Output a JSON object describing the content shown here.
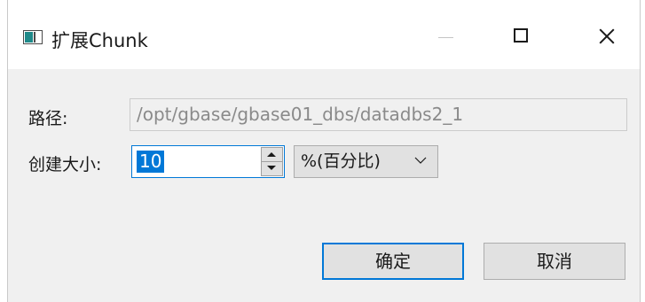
{
  "window": {
    "title": "扩展Chunk"
  },
  "titlebar_icons": {
    "app": "window-app-icon",
    "minimize": "minimize-icon",
    "maximize": "maximize-icon",
    "close": "close-icon"
  },
  "form": {
    "path_label": "路径:",
    "path_value": "/opt/gbase/gbase01_dbs/datadbs2_1",
    "size_label": "创建大小:",
    "size_value": "10",
    "unit_selected": "%(百分比)"
  },
  "buttons": {
    "ok": "确定",
    "cancel": "取消"
  },
  "colors": {
    "accent": "#0078d7",
    "dialog_bg": "#f0f0f0",
    "button_bg": "#e1e1e1",
    "disabled_text": "#8a8a8a"
  }
}
